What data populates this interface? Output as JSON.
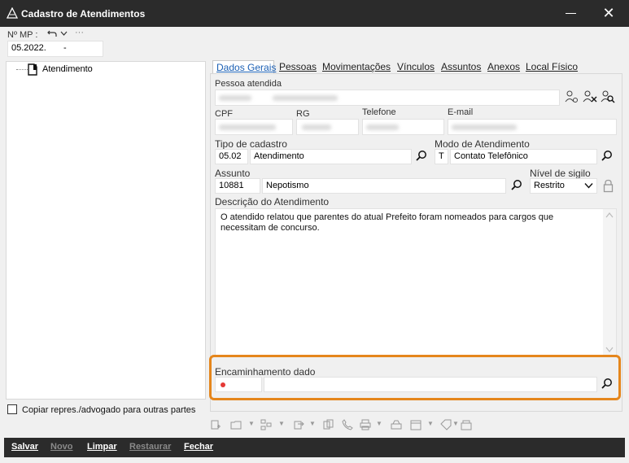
{
  "window": {
    "title": "Cadastro de Atendimentos",
    "close_glyph": "✕"
  },
  "header": {
    "mp_label": "Nº MP :",
    "mp_value": "05.2022.",
    "mp_suffix": "-"
  },
  "tree": {
    "root_label": "Atendimento"
  },
  "tabs": [
    {
      "label": "Dados Gerais",
      "active": true
    },
    {
      "label": "Pessoas"
    },
    {
      "label": "Movimentações"
    },
    {
      "label": "Vínculos"
    },
    {
      "label": "Assuntos"
    },
    {
      "label": "Anexos"
    },
    {
      "label": "Local Físico"
    }
  ],
  "form": {
    "pessoa_label": "Pessoa atendida",
    "cpf_label": "CPF",
    "rg_label": "RG",
    "telefone_label": "Telefone",
    "email_label": "E-mail",
    "tipo_label": "Tipo de cadastro",
    "tipo_code": "05.02",
    "tipo_value": "Atendimento",
    "modo_label": "Modo de Atendimento",
    "modo_code": "T",
    "modo_value": "Contato Telefônico",
    "assunto_label": "Assunto",
    "assunto_code": "10881",
    "assunto_value": "Nepotismo",
    "sigilo_label": "Nível de sigilo",
    "sigilo_value": "Restrito",
    "descricao_label": "Descrição do Atendimento",
    "descricao_text": "O atendido relatou que parentes do atual Prefeito foram nomeados para cargos que necessitam de concurso.",
    "encaminhamento_label": "Encaminhamento dado"
  },
  "copy_checkbox_label": "Copiar repres./advogado para outras partes",
  "bottom_buttons": [
    {
      "label": "Salvar",
      "enabled": true
    },
    {
      "label": "Novo",
      "enabled": false
    },
    {
      "label": "Limpar",
      "enabled": true
    },
    {
      "label": "Restaurar",
      "enabled": false
    },
    {
      "label": "Fechar",
      "enabled": true
    }
  ],
  "colors": {
    "accent": "#1a5fb4",
    "highlight": "#e5861c",
    "required_dot": "#e53935",
    "titlebar": "#2b2b2b"
  }
}
